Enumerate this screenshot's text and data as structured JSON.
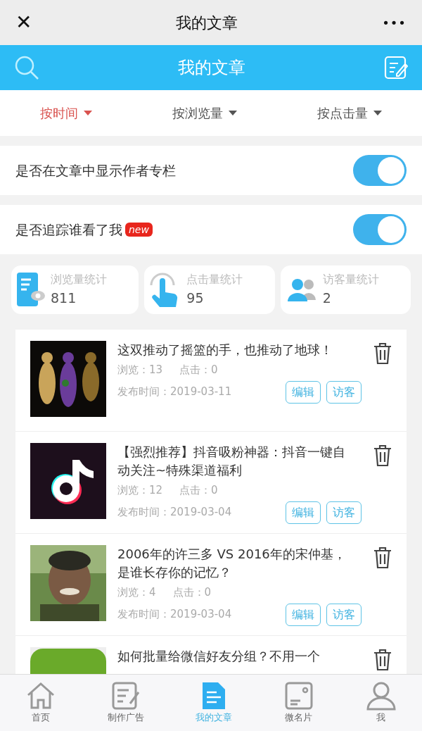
{
  "window": {
    "title": "我的文章",
    "close": "✕",
    "more": "•••"
  },
  "header": {
    "title": "我的文章"
  },
  "sort_options": [
    {
      "label": "按时间",
      "selected": true
    },
    {
      "label": "按浏览量",
      "selected": false
    },
    {
      "label": "按点击量",
      "selected": false
    }
  ],
  "settings": [
    {
      "label": "是否在文章中显示作者专栏",
      "on": true
    },
    {
      "label": "是否追踪谁看了我",
      "badge": "new",
      "on": true
    }
  ],
  "stats": [
    {
      "kind": "views",
      "label": "浏览量统计",
      "value": "811"
    },
    {
      "kind": "clicks",
      "label": "点击量统计",
      "value": "95"
    },
    {
      "kind": "visitors",
      "label": "访客量统计",
      "value": "2"
    }
  ],
  "articles": [
    {
      "title": "这双推动了摇篮的手，也推动了地球！",
      "views": "浏览：13",
      "clicks": "点击：0",
      "date": "发布时间：2019-03-11",
      "buttons": [
        "编辑",
        "访客"
      ]
    },
    {
      "title": "【强烈推荐】抖音吸粉神器：抖音一键自动关注~特殊渠道福利",
      "views": "浏览：12",
      "clicks": "点击：0",
      "date": "发布时间：2019-03-04",
      "buttons": [
        "编辑",
        "访客"
      ]
    },
    {
      "title": "2006年的许三多 VS 2016年的宋仲基，是谁长存你的记忆？",
      "views": "浏览：4",
      "clicks": "点击：0",
      "date": "发布时间：2019-03-04",
      "buttons": [
        "编辑",
        "访客"
      ]
    },
    {
      "title": "如何批量给微信好友分组？不用一个"
    }
  ],
  "tab_bar": [
    {
      "kind": "home",
      "label": "首页",
      "selected": false
    },
    {
      "kind": "ad",
      "label": "制作广告",
      "selected": false
    },
    {
      "kind": "article",
      "label": "我的文章",
      "selected": true
    },
    {
      "kind": "card",
      "label": "微名片",
      "selected": false
    },
    {
      "kind": "me",
      "label": "我",
      "selected": false
    }
  ]
}
